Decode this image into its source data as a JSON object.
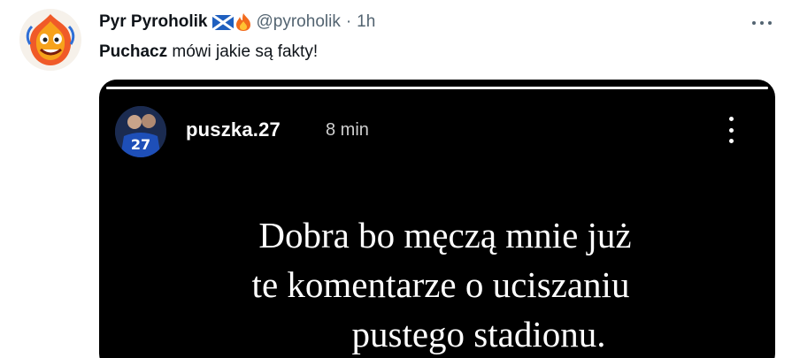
{
  "tweet": {
    "author_name": "Pyr Pyroholik",
    "author_handle": "@pyroholik",
    "separator": "·",
    "time": "1h",
    "text_bold": "Puchacz",
    "text_rest": " mówi jakie są fakty!"
  },
  "story": {
    "username": "puszka.27",
    "time": "8 min",
    "progress": 1.0,
    "lines": [
      "Dobra bo męczą mnie już",
      "te komentarze o uciszaniu",
      "pustego stadionu."
    ]
  },
  "icons": {
    "flag": "scotland-flag-icon",
    "fire": "fire-icon",
    "more": "more-horizontal-icon",
    "story_menu": "more-vertical-icon"
  },
  "colors": {
    "text": "#0f1419",
    "muted": "#536471",
    "media_bg": "#000000",
    "story_text": "#ffffff"
  }
}
